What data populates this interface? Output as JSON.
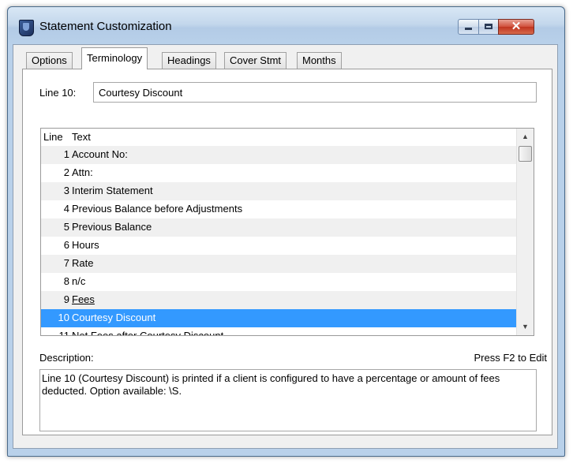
{
  "window": {
    "title": "Statement Customization"
  },
  "tabs": [
    {
      "label": "Options"
    },
    {
      "label": "Terminology"
    },
    {
      "label": "Headings"
    },
    {
      "label": "Cover Stmt"
    },
    {
      "label": "Months"
    }
  ],
  "active_tab": "Terminology",
  "line_field": {
    "label": "Line 10:",
    "value": "Courtesy Discount"
  },
  "grid": {
    "columns": [
      "Line",
      "Text"
    ],
    "rows": [
      {
        "line": "1",
        "text": "Account No:"
      },
      {
        "line": "2",
        "text": "Attn:"
      },
      {
        "line": "3",
        "text": "Interim Statement"
      },
      {
        "line": "4",
        "text": "Previous Balance before Adjustments"
      },
      {
        "line": "5",
        "text": "Previous Balance"
      },
      {
        "line": "6",
        "text": "Hours"
      },
      {
        "line": "7",
        "text": "Rate"
      },
      {
        "line": "8",
        "text": "n/c"
      },
      {
        "line": "9",
        "text": "Fees"
      },
      {
        "line": "10",
        "text": "Courtesy Discount"
      },
      {
        "line": "11",
        "text": "Net Fees after Courtesy Discount"
      }
    ],
    "selected_line": "10"
  },
  "description": {
    "label": "Description:",
    "hint": "Press F2 to Edit",
    "text": "Line 10 (Courtesy Discount) is printed if a client is configured to have a percentage or amount of fees deducted.  Option available: \\S."
  },
  "colors": {
    "selection": "#3399ff",
    "close_button": "#c0341f"
  }
}
